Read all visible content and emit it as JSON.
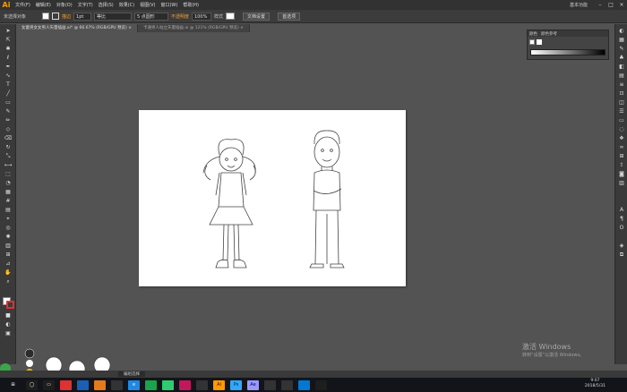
{
  "app": {
    "logo": "Ai",
    "workspace": "基本功能",
    "menu": [
      "文件(F)",
      "编辑(E)",
      "对象(O)",
      "文字(T)",
      "选择(S)",
      "效果(C)",
      "视图(V)",
      "窗口(W)",
      "帮助(H)"
    ]
  },
  "control": {
    "selection": "未选择对象",
    "stroke_label": "描边",
    "stroke_width": "1pt",
    "uniform": "等比",
    "points": "5 点圆形",
    "opacity_label": "不透明度",
    "opacity": "100%",
    "style_label": "样式",
    "doc_setup": "文档设置",
    "prefs": "首选项"
  },
  "tabs": [
    {
      "label": "女童男女女男人矢量插画.ai* @ 66.67% (RGB/GPU 预览)",
      "active": true
    },
    {
      "label": "卡通男人站立矢量插画.ai @ 121% (RGB/GPU 预览)",
      "active": false
    }
  ],
  "gradient_panel": {
    "tab1": "颜色",
    "tab2": "颜色参考"
  },
  "status": {
    "zoom": "66.67%",
    "tool": "编组选择"
  },
  "watermark": {
    "line1": "激活 Windows",
    "line2": "转到“设置”以激活 Windows。"
  },
  "taskbar": {
    "time": "9:07",
    "date": "2018/5/31"
  },
  "colors": {
    "accent": "#ff9a00",
    "artboard": "#ffffff",
    "canvas": "#535353"
  }
}
